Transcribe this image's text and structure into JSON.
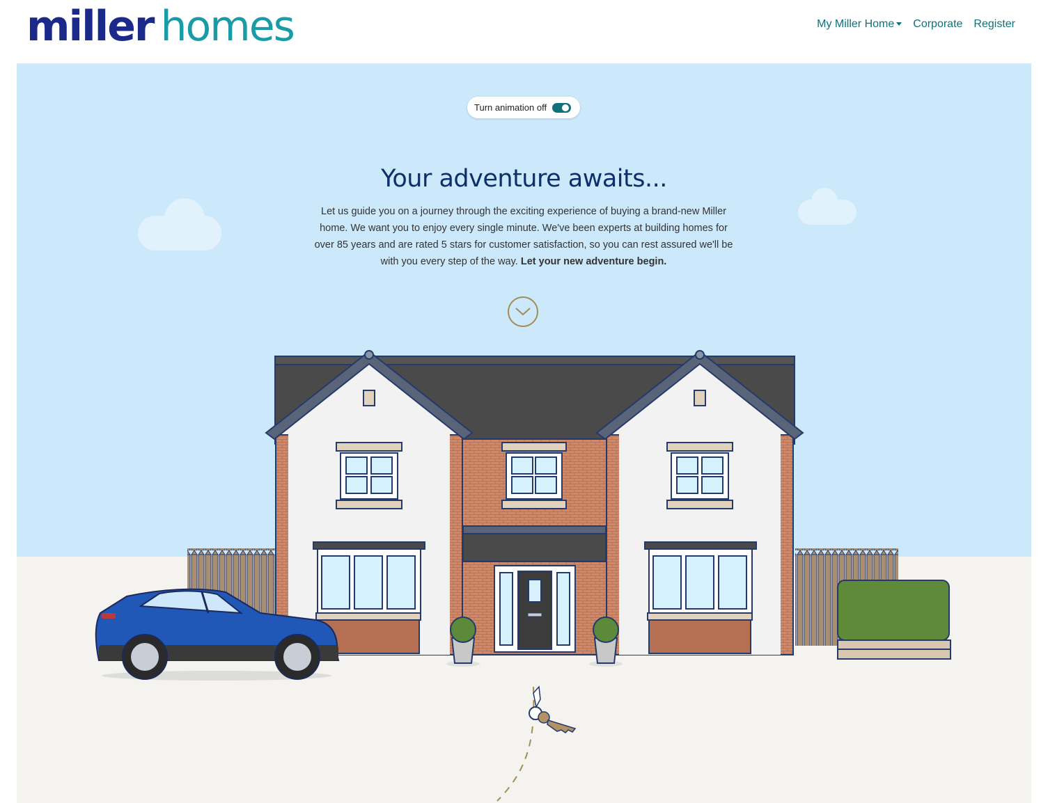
{
  "brand": {
    "logo_word1": "miller",
    "logo_word2": "homes"
  },
  "nav": {
    "my_home": "My Miller Home",
    "corporate": "Corporate",
    "register": "Register"
  },
  "hero": {
    "toggle_label": "Turn animation off",
    "toggle_on": true,
    "title": "Your adventure awaits...",
    "intro": "Let us guide you on a journey through the exciting experience of buying a brand-new Miller home. We want you to enjoy every single minute. We've been experts at building homes for over 85 years and are rated 5 stars for customer satisfaction, so you can rest assured we'll be with you every step of the way.",
    "intro_bold": "Let your new adventure begin."
  },
  "colors": {
    "sky": "#cce8fb",
    "ground": "#f4f3ef",
    "brand_navy": "#1b2a8a",
    "brand_teal": "#1a9ca6",
    "nav_teal": "#10707b",
    "title_navy": "#0d2f6a",
    "accent_gold": "#a38c55"
  },
  "icons": {
    "scroll": "chevron-down-icon",
    "nav_dropdown": "caret-down-icon"
  }
}
